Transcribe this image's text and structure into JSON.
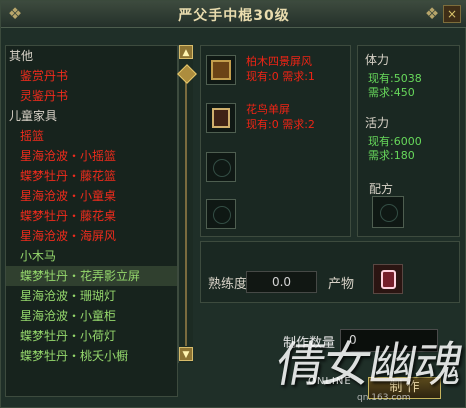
{
  "window": {
    "title": "严父手中棍30级",
    "close": "×"
  },
  "left_list": {
    "items": [
      {
        "text": "其他",
        "style": "cat"
      },
      {
        "text": "鉴赏丹书",
        "style": "red"
      },
      {
        "text": "灵鉴丹书",
        "style": "red"
      },
      {
        "text": "儿童家具",
        "style": "cat"
      },
      {
        "text": "摇篮",
        "style": "red"
      },
      {
        "text": "星海沧波・小摇篮",
        "style": "red"
      },
      {
        "text": "蝶梦牡丹・藤花篮",
        "style": "red"
      },
      {
        "text": "星海沧波・小童桌",
        "style": "red"
      },
      {
        "text": "蝶梦牡丹・藤花桌",
        "style": "red"
      },
      {
        "text": "星海沧波・海屏风",
        "style": "red"
      },
      {
        "text": "小木马",
        "style": "green"
      },
      {
        "text": "蝶梦牡丹・花弄影立屏",
        "style": "green selected"
      },
      {
        "text": "星海沧波・珊瑚灯",
        "style": "green"
      },
      {
        "text": "星海沧波・小童柜",
        "style": "green"
      },
      {
        "text": "蝶梦牡丹・小荷灯",
        "style": "green"
      },
      {
        "text": "蝶梦牡丹・桃夭小橱",
        "style": "green"
      }
    ]
  },
  "materials": [
    {
      "name": "柏木四景屏风",
      "line2": "现有:0 需求:1"
    },
    {
      "name": "花鸟单屏",
      "line2": "现有:0 需求:2"
    }
  ],
  "requirements": {
    "stamina_label": "体力",
    "stamina_have": "现有:5038",
    "stamina_need": "需求:450",
    "vitality_label": "活力",
    "vitality_have": "现有:6000",
    "vitality_need": "需求:180",
    "formula_label": "配方"
  },
  "production": {
    "proficiency_label": "熟练度",
    "proficiency_value": "0.0",
    "product_label": "产物"
  },
  "crafting": {
    "quantity_label": "制作数量",
    "quantity_value": "0",
    "button": "制  作"
  },
  "watermark": {
    "logo": "倩女幽魂",
    "online": "ONLINE",
    "url": "qn.163.com"
  },
  "colors": {
    "red_item": "#f02b1c",
    "green_item": "#95d86c",
    "stats": "#67d85b"
  }
}
